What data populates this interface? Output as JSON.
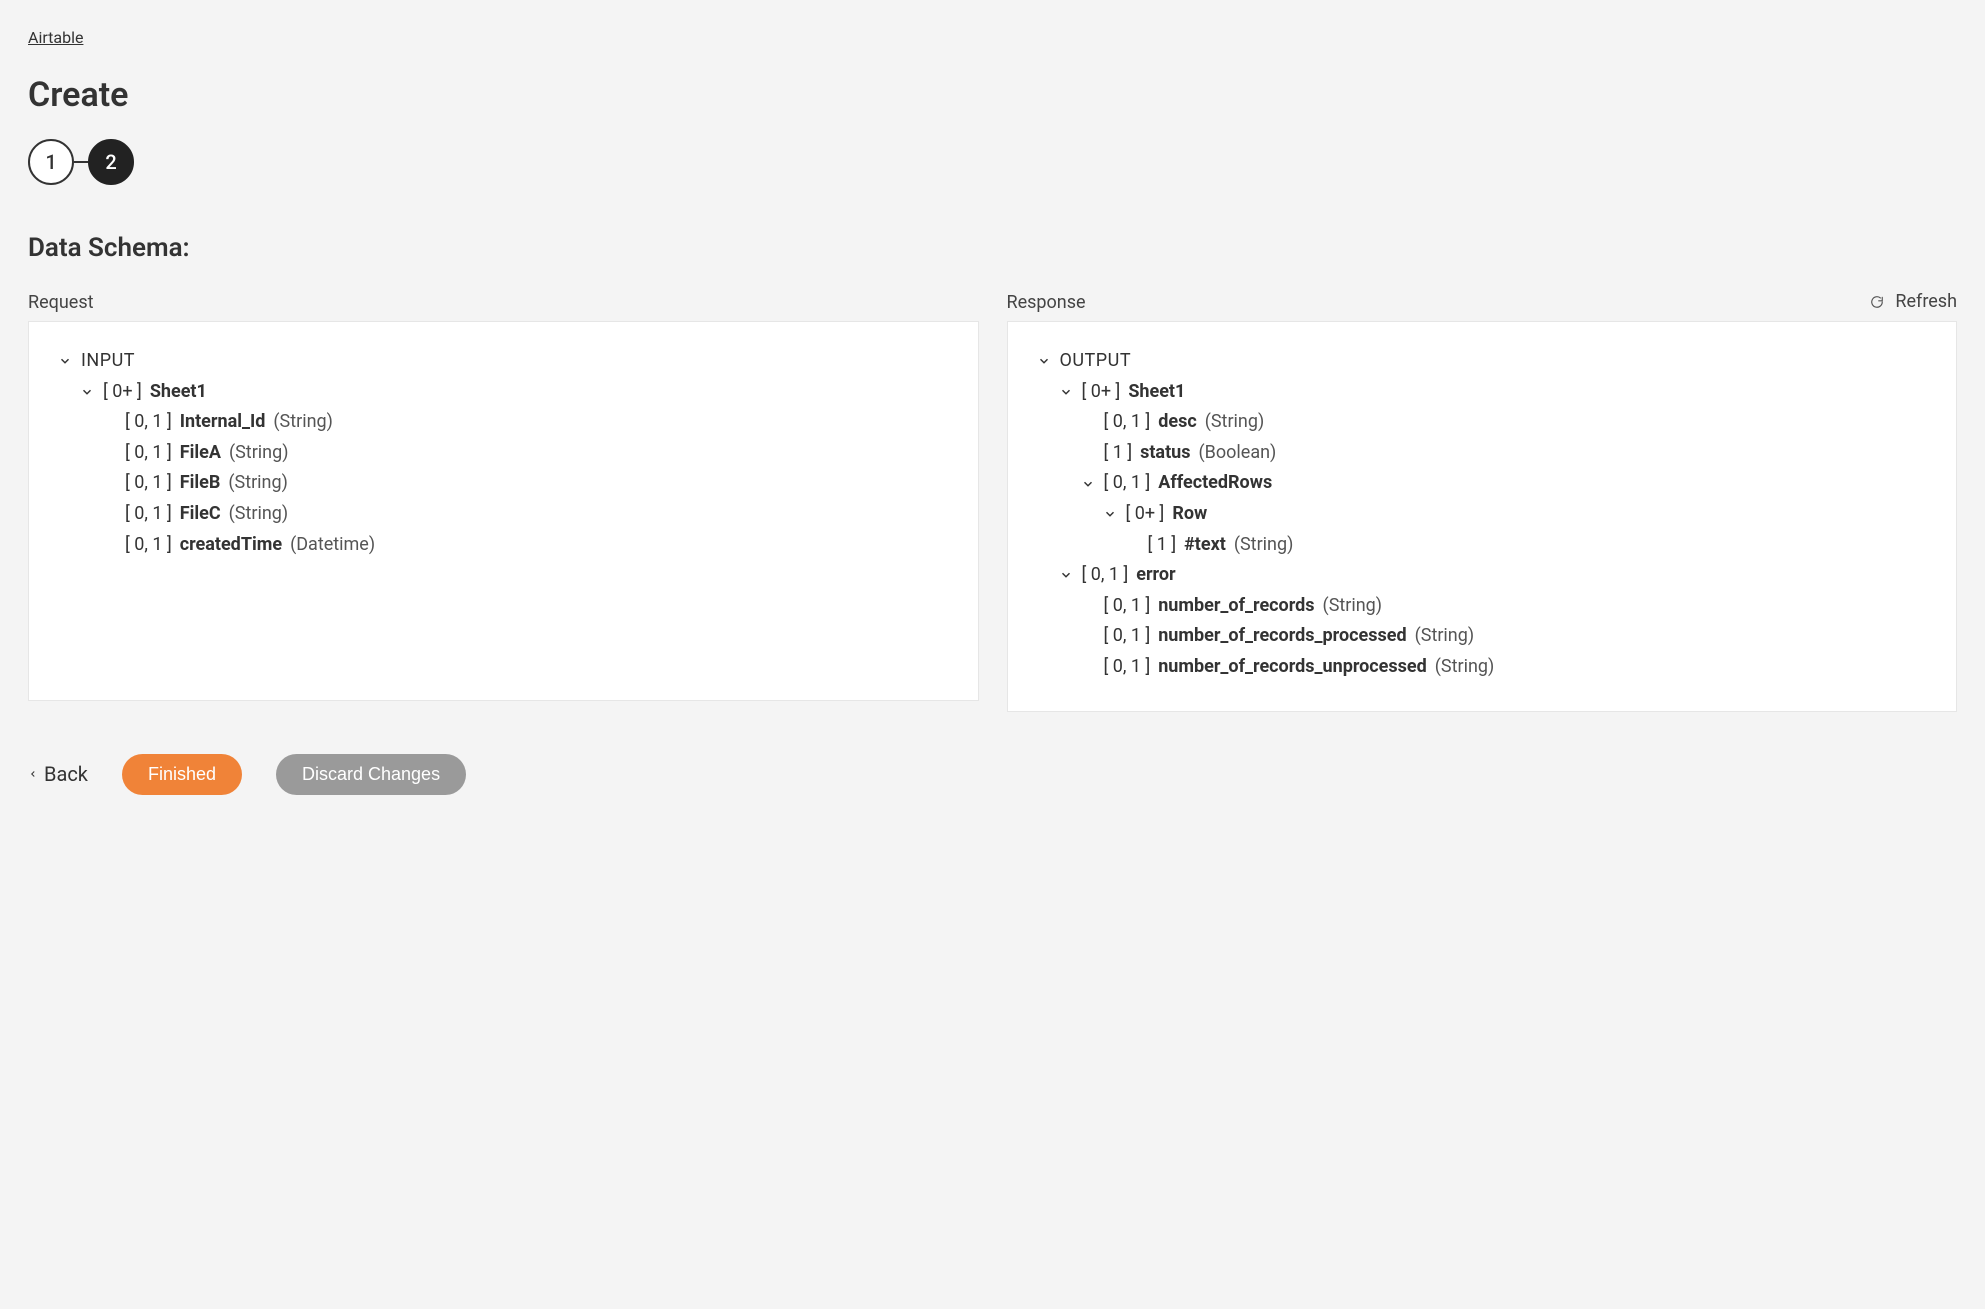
{
  "breadcrumb": "Airtable",
  "page_title": "Create",
  "stepper": {
    "step1": "1",
    "step2": "2"
  },
  "section_heading": "Data Schema:",
  "refresh_label": "Refresh",
  "request_label": "Request",
  "response_label": "Response",
  "request_tree": {
    "root": "INPUT",
    "sheet_card": "[ 0+ ]",
    "sheet_name": "Sheet1",
    "fields": [
      {
        "card": "[ 0, 1 ]",
        "name": "Internal_Id",
        "type": "(String)"
      },
      {
        "card": "[ 0, 1 ]",
        "name": "FileA",
        "type": "(String)"
      },
      {
        "card": "[ 0, 1 ]",
        "name": "FileB",
        "type": "(String)"
      },
      {
        "card": "[ 0, 1 ]",
        "name": "FileC",
        "type": "(String)"
      },
      {
        "card": "[ 0, 1 ]",
        "name": "createdTime",
        "type": "(Datetime)"
      }
    ]
  },
  "response_tree": {
    "root": "OUTPUT",
    "sheet_card": "[ 0+ ]",
    "sheet_name": "Sheet1",
    "sheet_fields": [
      {
        "card": "[ 0, 1 ]",
        "name": "desc",
        "type": "(String)"
      },
      {
        "card": "[ 1 ]",
        "name": "status",
        "type": "(Boolean)"
      }
    ],
    "affected_card": "[ 0, 1 ]",
    "affected_name": "AffectedRows",
    "row_card": "[ 0+ ]",
    "row_name": "Row",
    "row_fields": [
      {
        "card": "[ 1 ]",
        "name": "#text",
        "type": "(String)"
      }
    ],
    "error_card": "[ 0, 1 ]",
    "error_name": "error",
    "error_fields": [
      {
        "card": "[ 0, 1 ]",
        "name": "number_of_records",
        "type": "(String)"
      },
      {
        "card": "[ 0, 1 ]",
        "name": "number_of_records_processed",
        "type": "(String)"
      },
      {
        "card": "[ 0, 1 ]",
        "name": "number_of_records_unprocessed",
        "type": "(String)"
      }
    ]
  },
  "footer": {
    "back": "Back",
    "finished": "Finished",
    "discard": "Discard Changes"
  }
}
